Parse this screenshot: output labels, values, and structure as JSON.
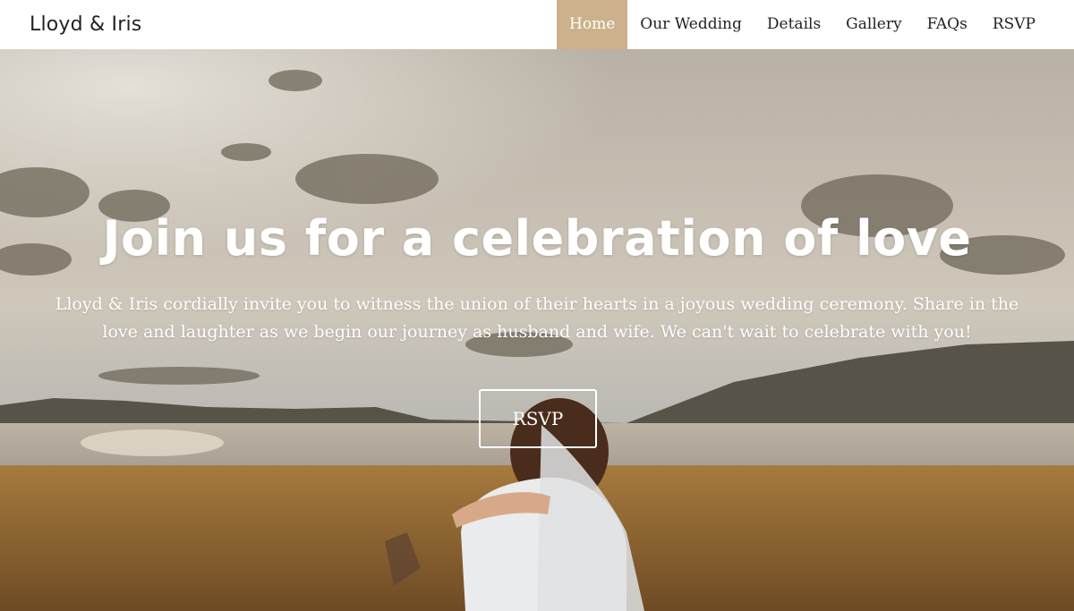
{
  "nav": {
    "brand": "Lloyd & Iris",
    "items": [
      {
        "label": "Home",
        "active": true
      },
      {
        "label": "Our Wedding",
        "active": false
      },
      {
        "label": "Details",
        "active": false
      },
      {
        "label": "Gallery",
        "active": false
      },
      {
        "label": "FAQs",
        "active": false
      },
      {
        "label": "RSVP",
        "active": false
      }
    ]
  },
  "hero": {
    "title": "Join us for a celebration of love",
    "subtitle": "Lloyd & Iris cordially invite you to witness the union of their hearts in a joyous wedding ceremony. Share in the love and laughter as we begin our journey as husband and wife. We can't wait to celebrate with you!",
    "button_label": "RSVP"
  },
  "colors": {
    "accent": "#cbb28c",
    "text": "#222222",
    "hero_text": "#ffffff"
  }
}
